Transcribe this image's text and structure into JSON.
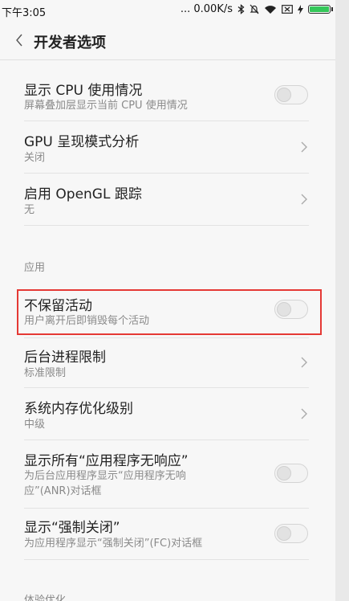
{
  "status": {
    "time": "下午3:05",
    "speed": "... 0.00K/s"
  },
  "header": {
    "title": "开发者选项"
  },
  "items": [
    {
      "label": "显示 CPU 使用情况",
      "sub": "屏幕叠加层显示当前 CPU 使用情况",
      "control": "toggle"
    },
    {
      "label": "GPU 呈现模式分析",
      "sub": "关闭",
      "control": "chevron"
    },
    {
      "label": "启用 OpenGL 跟踪",
      "sub": "无",
      "control": "chevron"
    }
  ],
  "sections": [
    {
      "title": "应用"
    },
    {
      "title": "体验优化"
    }
  ],
  "app_items": [
    {
      "label": "不保留活动",
      "sub": "用户离开后即销毁每个活动",
      "control": "toggle"
    },
    {
      "label": "后台进程限制",
      "sub": "标准限制",
      "control": "chevron"
    },
    {
      "label": "系统内存优化级别",
      "sub": "中级",
      "control": "chevron"
    },
    {
      "label": "显示所有“应用程序无响应”",
      "sub": "为后台应用程序显示“应用程序无响应”(ANR)对话框",
      "sub_line1": "为后台应用程序显示“应用程序无响",
      "sub_line2": "应”(ANR)对话框",
      "control": "toggle"
    },
    {
      "label": "显示“强制关闭”",
      "sub": "为应用程序显示“强制关闭”(FC)对话框",
      "control": "toggle"
    }
  ],
  "colors": {
    "highlight": "#e53935",
    "battery": "#34c759"
  }
}
